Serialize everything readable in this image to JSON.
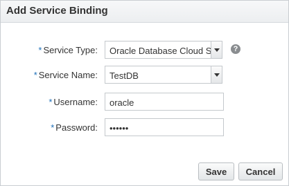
{
  "dialog": {
    "title": "Add Service Binding"
  },
  "form": {
    "required_marker": "*",
    "service_type": {
      "label": "Service Type:",
      "value": "Oracle Database Cloud Se",
      "help_icon": "?"
    },
    "service_name": {
      "label": "Service Name:",
      "value": "TestDB"
    },
    "username": {
      "label": "Username:",
      "value": "oracle"
    },
    "password": {
      "label": "Password:",
      "value": "••••••"
    }
  },
  "buttons": {
    "save_label": "Save",
    "cancel_label": "Cancel"
  },
  "icons": {
    "help": "help-icon",
    "dropdown": "chevron-down-icon"
  },
  "colors": {
    "required_marker": "#1d6fb8",
    "help_icon": "#8a8d90"
  }
}
